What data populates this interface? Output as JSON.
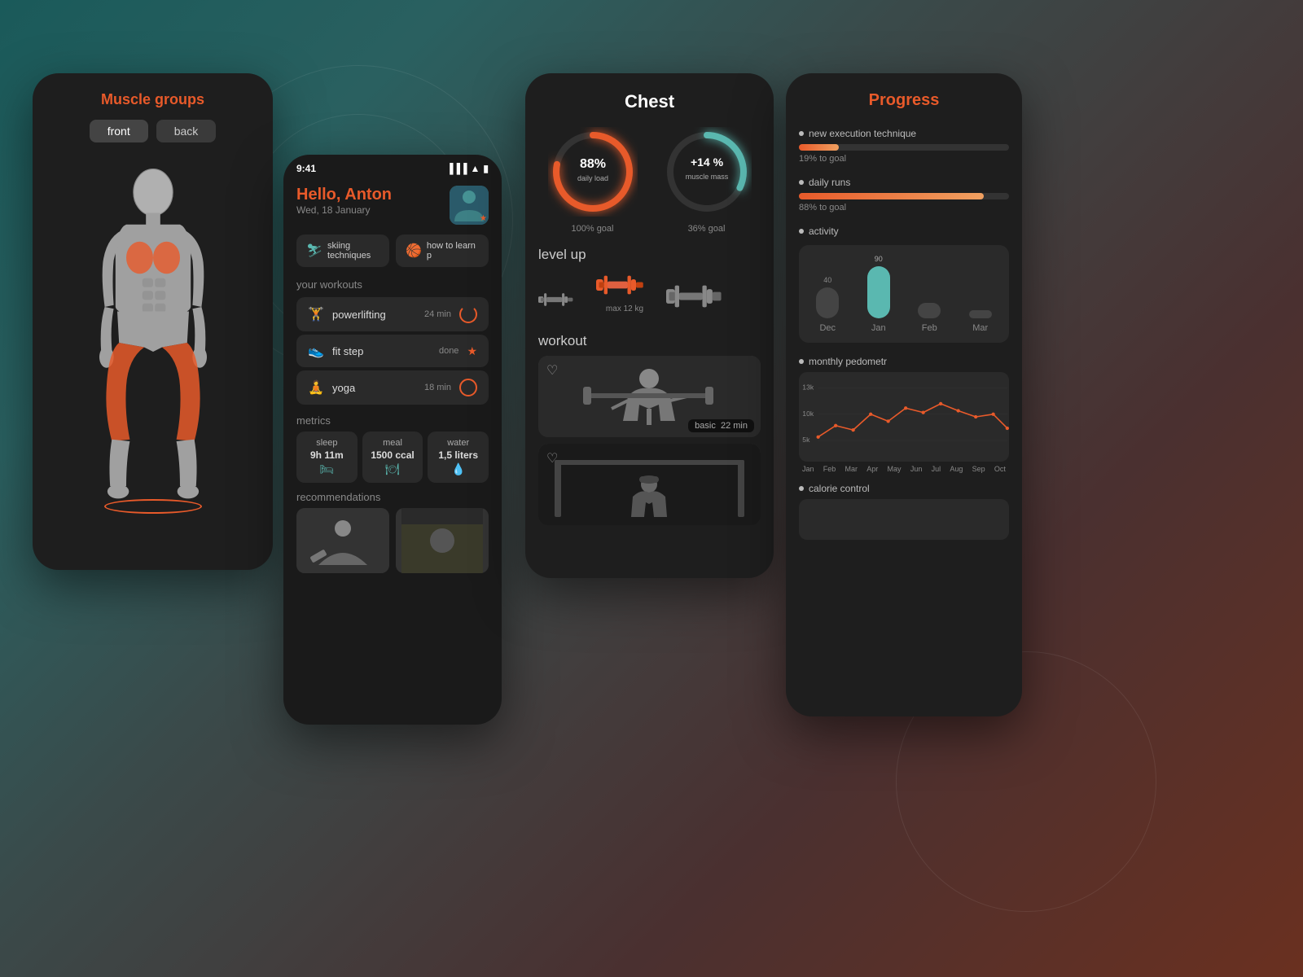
{
  "background": {
    "color_start": "#1a5a5a",
    "color_end": "#6a3020"
  },
  "card1": {
    "title": "Muscle groups",
    "toggle": {
      "front": "front",
      "back": "back",
      "active": "front"
    }
  },
  "card2": {
    "status_bar": {
      "time": "9:41"
    },
    "greeting": "Hello, Anton",
    "date": "Wed, 18 January",
    "activities": [
      {
        "label": "skiing techniques",
        "icon": "🎿"
      },
      {
        "label": "how to learn p",
        "icon": "🏀"
      }
    ],
    "workouts_label": "your workouts",
    "workouts": [
      {
        "name": "powerlifting",
        "meta": "24 min",
        "status": "progress"
      },
      {
        "name": "fit step",
        "meta": "done",
        "status": "star"
      },
      {
        "name": "yoga",
        "meta": "18 min",
        "status": "progress"
      }
    ],
    "metrics_label": "metrics",
    "metrics": [
      {
        "label": "sleep",
        "value": "9h 11m",
        "icon": "🛏"
      },
      {
        "label": "meal",
        "value": "1500 ccal",
        "icon": "🍽"
      },
      {
        "label": "water",
        "value": "1,5 liters",
        "icon": "💧"
      }
    ],
    "recommendations_label": "recommendations"
  },
  "card3": {
    "title": "Chest",
    "rings": [
      {
        "value": "88%",
        "sublabel": "daily load",
        "goal": "100% goal",
        "color": "orange",
        "pct": 88
      },
      {
        "value": "+14 %",
        "sublabel": "muscle mass",
        "goal": "36% goal",
        "color": "cyan",
        "pct": 36
      }
    ],
    "level_up_label": "level up",
    "weights": [
      {
        "size": "small",
        "highlight": false
      },
      {
        "size": "medium",
        "highlight": true
      },
      {
        "size": "large",
        "highlight": false
      }
    ],
    "max_weight": "max 12 kg",
    "workout_label": "workout",
    "workout_videos": [
      {
        "badge": "basic",
        "duration": "22 min"
      },
      {}
    ]
  },
  "card4": {
    "title": "Progress",
    "items": [
      {
        "label": "new execution technique",
        "pct": 19,
        "pct_label": "19% to goal"
      },
      {
        "label": "daily runs",
        "pct": 88,
        "pct_label": "88% to goal"
      }
    ],
    "activity_label": "activity",
    "activity_bars": [
      {
        "month": "Dec",
        "pct": 40,
        "active": false
      },
      {
        "month": "Jan",
        "pct": 90,
        "active": true
      },
      {
        "month": "Feb",
        "pct": 20,
        "active": false
      },
      {
        "month": "Mar",
        "pct": 10,
        "active": false
      }
    ],
    "pedometer_label": "monthly pedometr",
    "chart_y": [
      "13k",
      "10k",
      "5k"
    ],
    "chart_x": [
      "Jan",
      "Feb",
      "Mar",
      "Apr",
      "May",
      "Jun",
      "Jul",
      "Aug",
      "Sep",
      "Oct"
    ],
    "calorie_label": "calorie control"
  }
}
